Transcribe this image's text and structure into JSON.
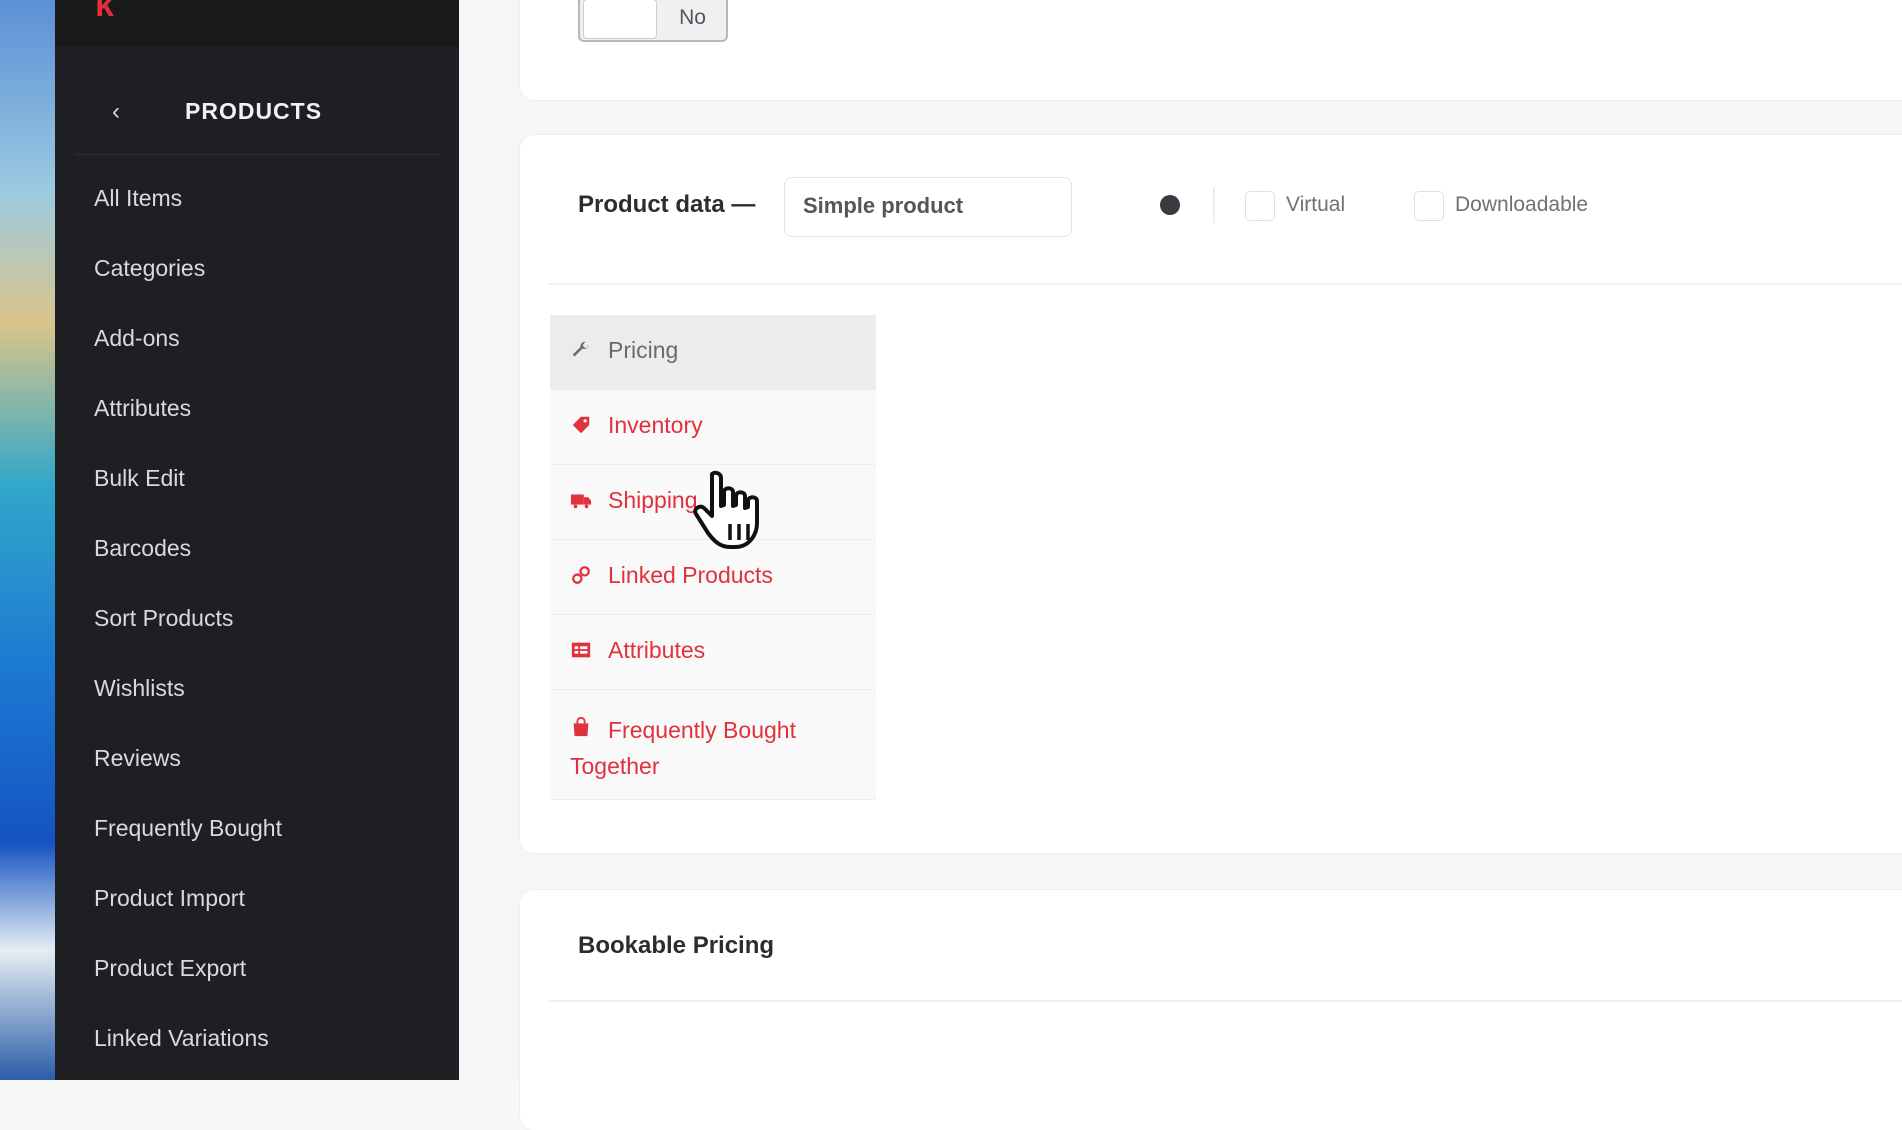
{
  "sidebar": {
    "brand": {
      "mark": "k",
      "name": ""
    },
    "header": {
      "back_icon": "chevron-left-icon",
      "title": "PRODUCTS"
    },
    "items": [
      {
        "label": "All Items"
      },
      {
        "label": "Categories"
      },
      {
        "label": "Add-ons"
      },
      {
        "label": "Attributes"
      },
      {
        "label": "Bulk Edit"
      },
      {
        "label": "Barcodes"
      },
      {
        "label": "Sort Products"
      },
      {
        "label": "Wishlists"
      },
      {
        "label": "Reviews"
      },
      {
        "label": "Frequently Bought"
      },
      {
        "label": "Product Import"
      },
      {
        "label": "Product Export"
      },
      {
        "label": "Linked Variations"
      }
    ]
  },
  "toggle": {
    "label": "No"
  },
  "product_data": {
    "label": "Product data —",
    "type_select": "Simple product",
    "virtual_label": "Virtual",
    "downloadable_label": "Downloadable",
    "tabs": [
      {
        "label": "Pricing",
        "icon": "wrench-icon",
        "active": true
      },
      {
        "label": "Inventory",
        "icon": "tag-icon"
      },
      {
        "label": "Shipping",
        "icon": "truck-icon"
      },
      {
        "label": "Linked Products",
        "icon": "link-icon"
      },
      {
        "label": "Attributes",
        "icon": "table-icon"
      },
      {
        "label": "Frequently Bought Together",
        "icon": "bag-icon"
      }
    ]
  },
  "bookable": {
    "title": "Bookable Pricing"
  },
  "colors": {
    "accent": "#e0313c",
    "sidebar_bg": "#1e1f23"
  }
}
